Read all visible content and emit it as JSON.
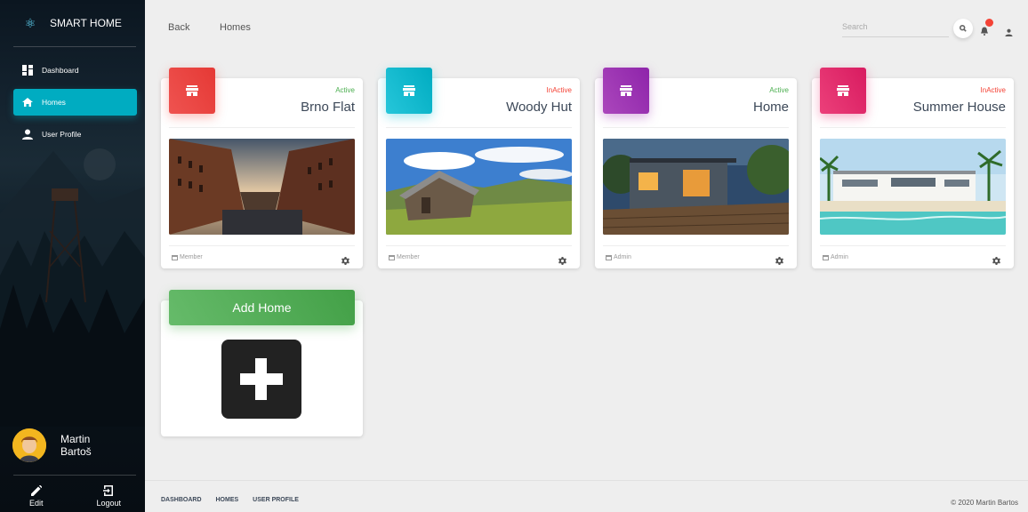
{
  "sidebar": {
    "brand": "SMART HOME",
    "items": [
      {
        "label": "Dashboard",
        "icon": "dashboard-icon"
      },
      {
        "label": "Homes",
        "icon": "home-icon"
      },
      {
        "label": "User Profile",
        "icon": "person-icon"
      }
    ],
    "user": {
      "first": "Martin",
      "last": "Bartoš"
    },
    "actions": [
      {
        "label": "Edit",
        "icon": "pencil-icon"
      },
      {
        "label": "Logout",
        "icon": "logout-icon"
      }
    ],
    "active_color": "#00acc1"
  },
  "topbar": {
    "back": "Back",
    "current": "Homes",
    "search_placeholder": "Search"
  },
  "homes": [
    {
      "status": "Active",
      "status_color": "#4caf50",
      "name": "Brno Flat",
      "role": "Member",
      "color": "#f44336"
    },
    {
      "status": "InActive",
      "status_color": "#f44336",
      "name": "Woody Hut",
      "role": "Member",
      "color": "#00bcd4"
    },
    {
      "status": "Active",
      "status_color": "#4caf50",
      "name": "Home",
      "role": "Admin",
      "color": "#9c27b0"
    },
    {
      "status": "InActive",
      "status_color": "#f44336",
      "name": "Summer House",
      "role": "Admin",
      "color": "#e91e63"
    }
  ],
  "add_home": {
    "label": "Add Home",
    "color": "#4caf50"
  },
  "footer": {
    "links": [
      "DASHBOARD",
      "HOMES",
      "USER PROFILE"
    ],
    "copyright": "© 2020 Martin Bartos"
  }
}
